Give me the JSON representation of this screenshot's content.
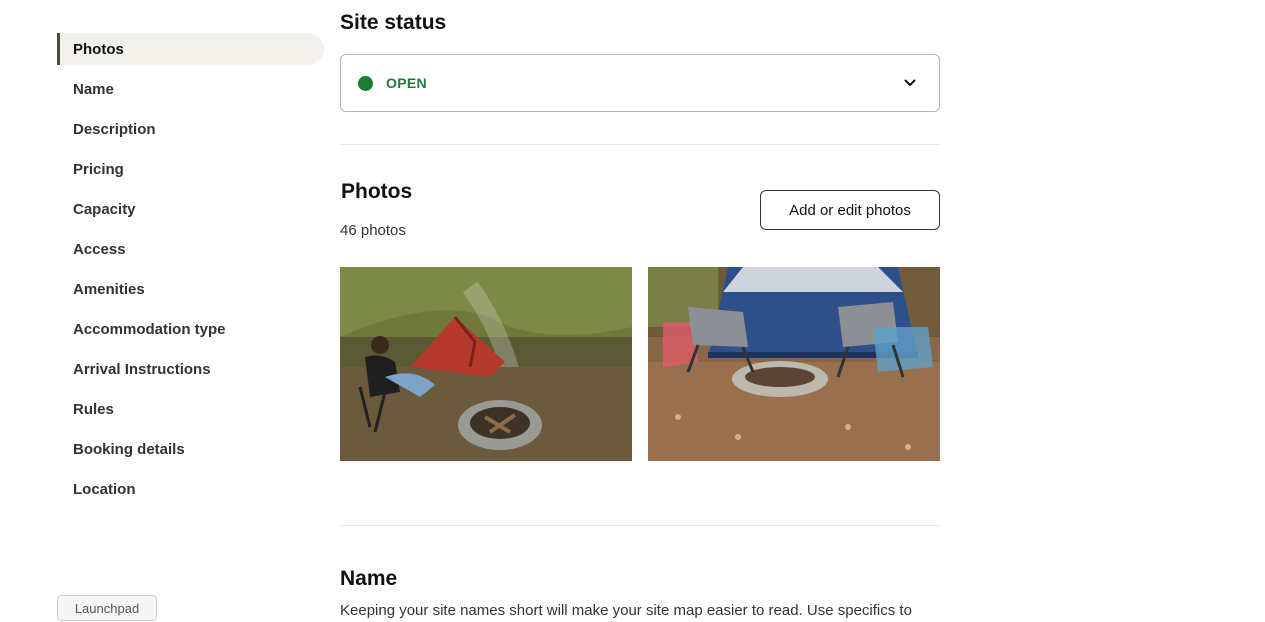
{
  "sidebar": {
    "items": [
      {
        "label": "Photos",
        "active": true
      },
      {
        "label": "Name"
      },
      {
        "label": "Description"
      },
      {
        "label": "Pricing"
      },
      {
        "label": "Capacity"
      },
      {
        "label": "Access"
      },
      {
        "label": "Amenities"
      },
      {
        "label": "Accommodation type"
      },
      {
        "label": "Arrival Instructions"
      },
      {
        "label": "Rules"
      },
      {
        "label": "Booking details"
      },
      {
        "label": "Location"
      }
    ]
  },
  "launchpad": {
    "label": "Launchpad"
  },
  "site_status": {
    "title": "Site status",
    "value": "OPEN",
    "color": "#1e7b34"
  },
  "photos": {
    "title": "Photos",
    "count": "46 photos",
    "edit_button": "Add or edit photos"
  },
  "name_section": {
    "title": "Name",
    "description": "Keeping your site names short will make your site map easier to read. Use specifics to"
  },
  "colors": {
    "accent": "#1e7b34",
    "active_bg": "#f2f1ec",
    "active_border": "#4b4b3a"
  }
}
